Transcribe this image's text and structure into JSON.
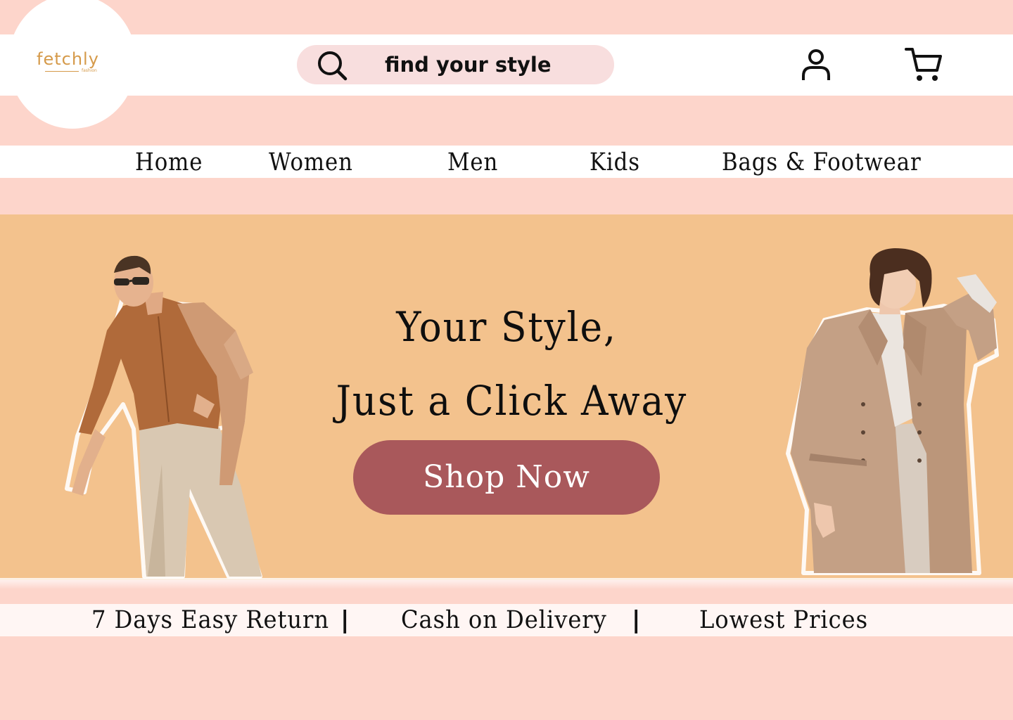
{
  "brand": {
    "name": "fetchly",
    "tagline": "fashion",
    "accent_color": "#d59a4a"
  },
  "search": {
    "placeholder": "find your style",
    "icon": "search-icon"
  },
  "header_icons": {
    "account": "user-icon",
    "cart": "cart-icon"
  },
  "nav": {
    "items": [
      {
        "label": "Home"
      },
      {
        "label": "Women"
      },
      {
        "label": "Men"
      },
      {
        "label": "Kids"
      },
      {
        "label": "Bags & Footwear"
      }
    ]
  },
  "hero": {
    "title_line1": "Your Style,",
    "title_line2": "Just a Click Away",
    "cta_label": "Shop Now",
    "background_color": "#f3c28d",
    "cta_color": "#a9585b"
  },
  "features": {
    "items": [
      {
        "label": "7 Days Easy Return"
      },
      {
        "label": "Cash on Delivery"
      },
      {
        "label": "Lowest Prices"
      }
    ],
    "separator": "|"
  },
  "colors": {
    "page_background": "#fdd5cb",
    "band_background": "#ffffff"
  }
}
